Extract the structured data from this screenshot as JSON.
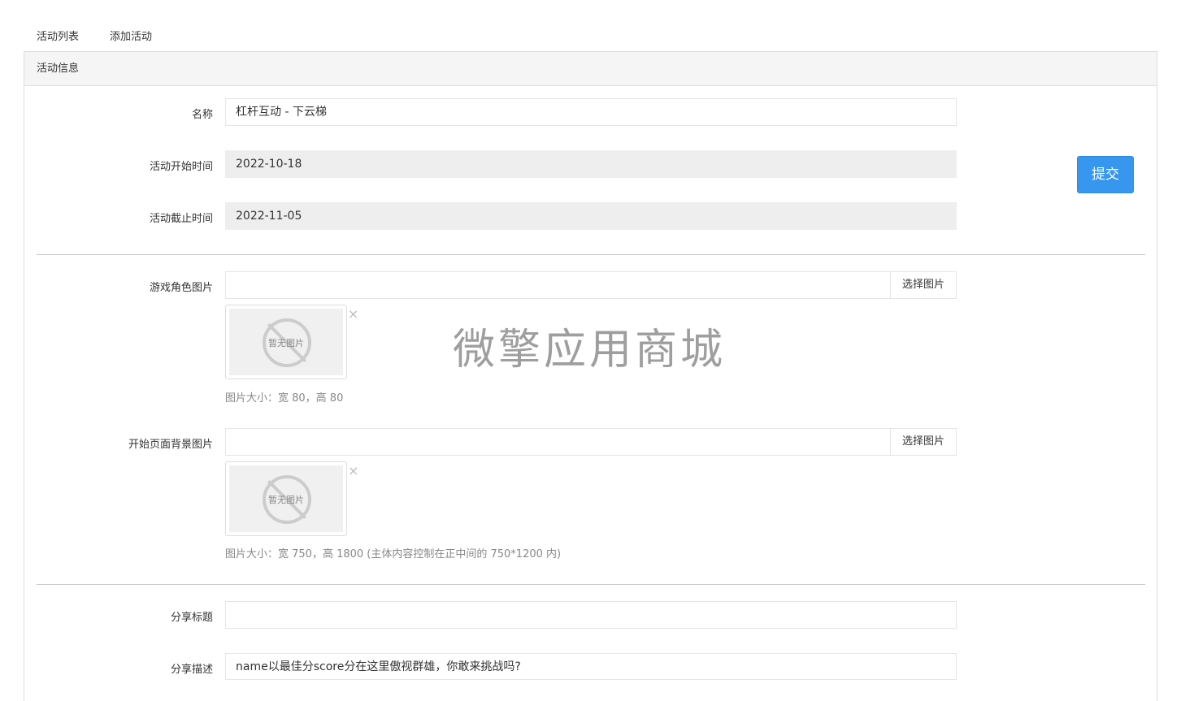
{
  "nav": {
    "tabs": [
      "活动列表",
      "添加活动"
    ]
  },
  "panel": {
    "title": "活动信息"
  },
  "form": {
    "name": {
      "label": "名称",
      "value": "杠杆互动 - 下云梯"
    },
    "start_time": {
      "label": "活动开始时间",
      "value": "2022-10-18"
    },
    "end_time": {
      "label": "活动截止时间",
      "value": "2022-11-05"
    },
    "role_image": {
      "label": "游戏角色图片",
      "value": "",
      "button": "选择图片",
      "placeholder_text": "暂无图片",
      "help": "图片大小：宽 80，高 80"
    },
    "start_bg_image": {
      "label": "开始页面背景图片",
      "value": "",
      "button": "选择图片",
      "placeholder_text": "暂无图片",
      "help": "图片大小：宽 750，高 1800 (主体内容控制在正中间的 750*1200 内)"
    },
    "share_title": {
      "label": "分享标题",
      "value": ""
    },
    "share_desc": {
      "label": "分享描述",
      "value": "name以最佳分score分在这里傲视群雄，你敢来挑战吗?"
    }
  },
  "submit_label": "提交",
  "close_glyph": "×",
  "watermark": "微擎应用商城",
  "colors": {
    "primary": "#3797ee",
    "readonly_bg": "#eeeeee"
  }
}
